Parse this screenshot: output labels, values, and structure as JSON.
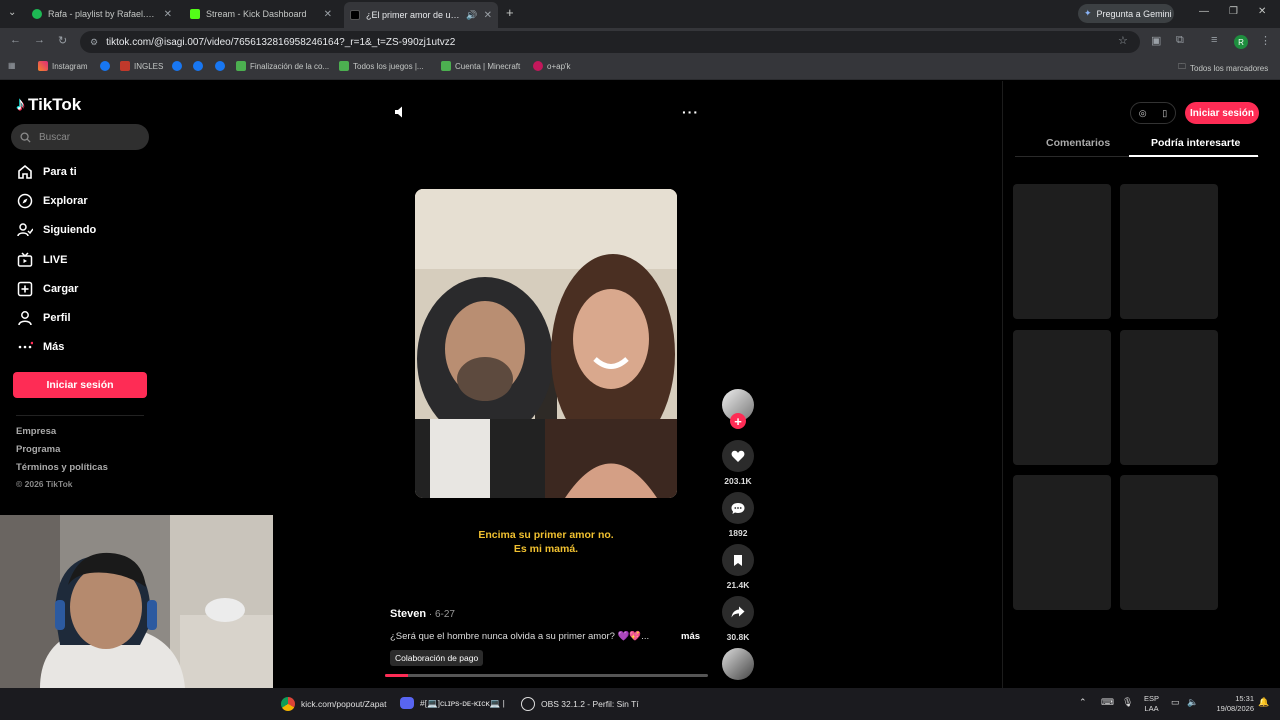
{
  "browser": {
    "tabs": [
      {
        "title": "Rafa - playlist by Rafael.xared |",
        "active": false
      },
      {
        "title": "Stream - Kick Dashboard",
        "active": false
      },
      {
        "title": "¿El primer amor de un hom",
        "active": true
      }
    ],
    "gemini_label": "Pregunta a Gemini",
    "url": "tiktok.com/@isagi.007/video/7656132816958246164?_r=1&_t=ZS-990zj1utvz2",
    "bookmarks": [
      "Instagram",
      "INGLES",
      "Finalización de la co...",
      "Todos los juegos |...",
      "Cuenta | Minecraft",
      "o+ap'k"
    ],
    "all_bookmarks_label": "Todos los marcadores"
  },
  "tiktok": {
    "logo": "TikTok",
    "search_placeholder": "Buscar",
    "nav": [
      {
        "label": "Para ti",
        "icon": "home-icon"
      },
      {
        "label": "Explorar",
        "icon": "compass-icon"
      },
      {
        "label": "Siguiendo",
        "icon": "following-icon"
      },
      {
        "label": "LIVE",
        "icon": "live-icon"
      },
      {
        "label": "Cargar",
        "icon": "upload-icon"
      },
      {
        "label": "Perfil",
        "icon": "profile-icon"
      },
      {
        "label": "Más",
        "icon": "more-icon"
      }
    ],
    "login_label": "Iniciar sesión",
    "footer": [
      "Empresa",
      "Programa",
      "Términos y políticas",
      "© 2026 TikTok"
    ],
    "video": {
      "overlay_line1": "Encima su primer amor no.",
      "overlay_line2": "Es mi mamá.",
      "author": "Steven",
      "date": " · 6-27",
      "description": "¿Será que el hombre nunca olvida a su primer amor? 💜💖...",
      "more_label": "más",
      "paid_label": "Colaboración de pago",
      "progress": 0.07,
      "likes": "203.1K",
      "comments": "1892",
      "saves": "21.4K",
      "shares": "30.8K"
    },
    "right_panel": {
      "login_label": "Iniciar sesión",
      "tab_comments": "Comentarios",
      "tab_recommended": "Podría interesarte"
    }
  },
  "taskbar": {
    "items": [
      "kick.com/popout/Zapat",
      "#[💻]ᴄʟɪᴘs-ᴅᴇ-ᴋɪᴄᴋ💻 |",
      "OBS 32.1.2 - Perfil: Sin Tí"
    ],
    "lang_line1": "ESP",
    "lang_line2": "LAA",
    "time": "15:31",
    "date": "19/08/2026"
  },
  "colors": {
    "accent": "#fe2c55",
    "caption": "#f0c030"
  }
}
